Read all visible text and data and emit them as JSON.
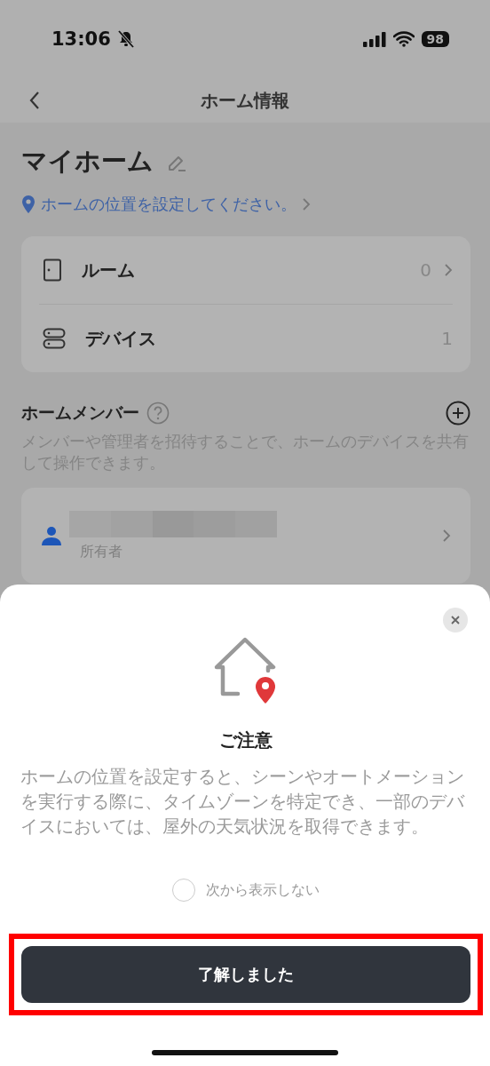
{
  "status_bar": {
    "time": "13:06",
    "silent": true,
    "battery": "98"
  },
  "nav": {
    "title": "ホーム情報"
  },
  "home": {
    "name": "マイホーム",
    "location_prompt": "ホームの位置を設定してください。"
  },
  "summary": [
    {
      "kind": "room",
      "label": "ルーム",
      "count": "0",
      "has_arrow": true
    },
    {
      "kind": "device",
      "label": "デバイス",
      "count": "1",
      "has_arrow": false
    }
  ],
  "members": {
    "title": "ホームメンバー",
    "description": "メンバーや管理者を招待することで、ホームのデバイスを共有して操作できます。",
    "list": [
      {
        "name_redacted": true,
        "role": "所有者"
      }
    ]
  },
  "notice": {
    "title": "ご注意",
    "body": "ホームの位置を設定すると、シーンやオートメーションを実行する際に、タイムゾーンを特定でき、一部のデバイスにおいては、屋外の天気状況を取得できます。",
    "dont_show_again": {
      "label": "次から表示しない",
      "checked": false
    },
    "confirm_button": {
      "label": "了解しました",
      "highlighted": true
    }
  }
}
